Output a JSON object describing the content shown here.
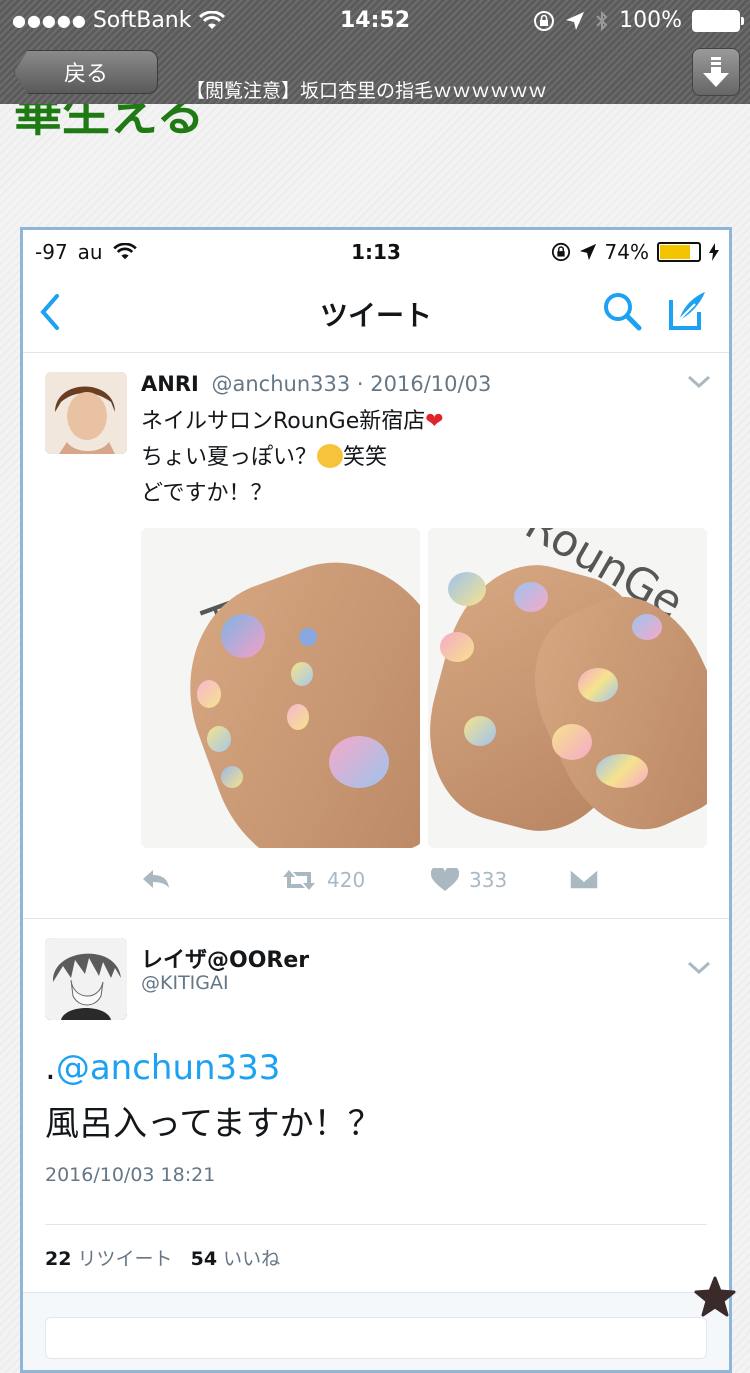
{
  "outer_status": {
    "carrier": "SoftBank",
    "time": "14:52",
    "battery": "100%"
  },
  "browser": {
    "back_label": "戻る",
    "page_title": "【閲覧注意】坂口杏里の指毛ｗｗｗｗｗｗ",
    "heading_fragment": "華生える"
  },
  "inner_status": {
    "signal": "-97",
    "carrier": "au",
    "time": "1:13",
    "battery": "74%"
  },
  "twitter_nav": {
    "title": "ツイート"
  },
  "tweet1": {
    "name": "ANRI",
    "meta": "@anchun333 · 2016/10/03",
    "line1": "ネイルサロンRounGe新宿店",
    "line2": "ちょい夏っぽい？",
    "line2_suffix": "笑笑",
    "line3": "どですか！？",
    "heart_emoji": "❤",
    "retweet_count": "420",
    "like_count": "333",
    "photo_left_text": "RounGe",
    "photo_right_text": "RounGe"
  },
  "tweet2": {
    "name": "レイザ@OORer",
    "handle": "@KITIGAI",
    "mention_dot": ".",
    "mention": "@anchun333",
    "body": "風呂入ってますか！？",
    "date": "2016/10/03 18:21",
    "retweet_num": "22",
    "retweet_label": "リツイート",
    "like_num": "54",
    "like_label": "いいね"
  },
  "colors": {
    "twitter_blue": "#1da1f2",
    "heading_green": "#1f7a14",
    "frame_border": "#8fb5d8",
    "battery_yellow": "#f5c400"
  }
}
